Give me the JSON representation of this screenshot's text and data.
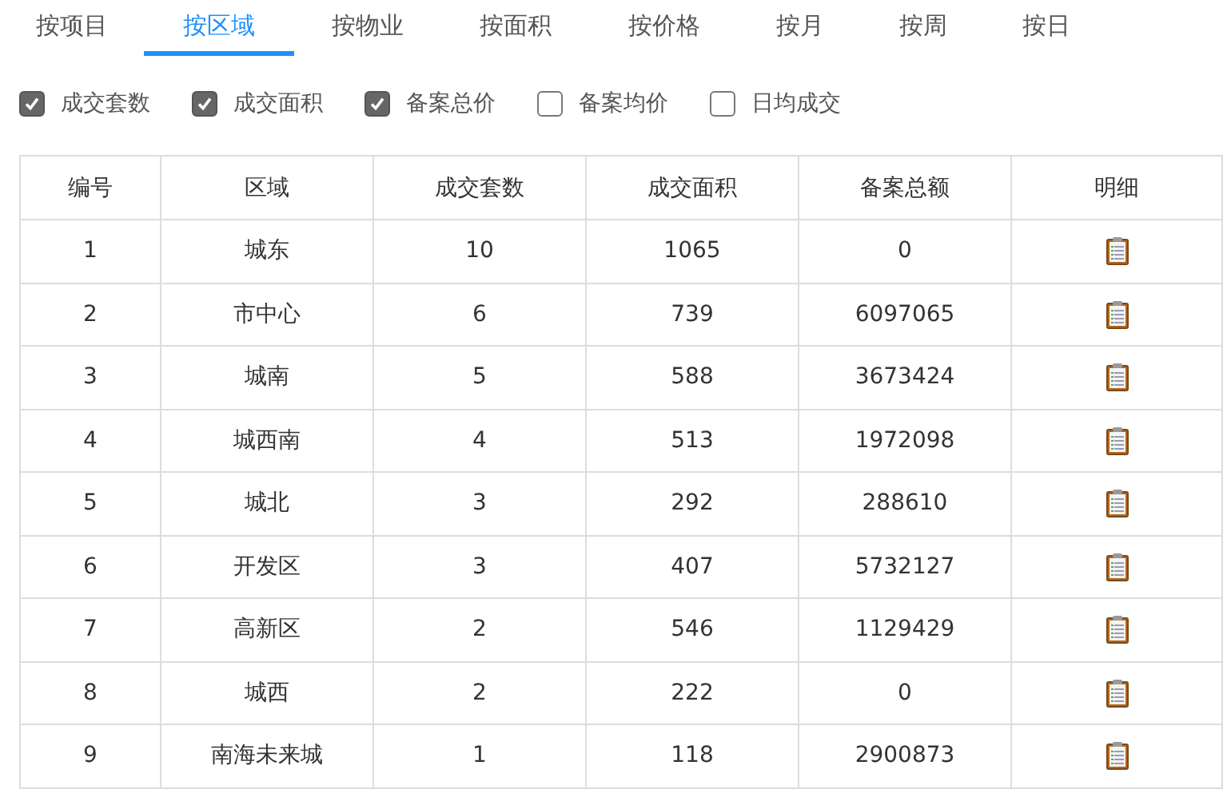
{
  "tabs": [
    {
      "label": "按项目",
      "selected": false
    },
    {
      "label": "按区域",
      "selected": true
    },
    {
      "label": "按物业",
      "selected": false
    },
    {
      "label": "按面积",
      "selected": false
    },
    {
      "label": "按价格",
      "selected": false
    },
    {
      "label": "按月",
      "selected": false
    },
    {
      "label": "按周",
      "selected": false
    },
    {
      "label": "按日",
      "selected": false
    }
  ],
  "options": [
    {
      "label": "成交套数",
      "checked": true
    },
    {
      "label": "成交面积",
      "checked": true
    },
    {
      "label": "备案总价",
      "checked": true
    },
    {
      "label": "备案均价",
      "checked": false
    },
    {
      "label": "日均成交",
      "checked": false
    }
  ],
  "table": {
    "columns": [
      "编号",
      "区域",
      "成交套数",
      "成交面积",
      "备案总额",
      "明细"
    ],
    "rows": [
      [
        "1",
        "城东",
        "10",
        "1065",
        "0"
      ],
      [
        "2",
        "市中心",
        "6",
        "739",
        "6097065"
      ],
      [
        "3",
        "城南",
        "5",
        "588",
        "3673424"
      ],
      [
        "4",
        "城西南",
        "4",
        "513",
        "1972098"
      ],
      [
        "5",
        "城北",
        "3",
        "292",
        "288610"
      ],
      [
        "6",
        "开发区",
        "3",
        "407",
        "5732127"
      ],
      [
        "7",
        "高新区",
        "2",
        "546",
        "1129429"
      ],
      [
        "8",
        "城西",
        "2",
        "222",
        "0"
      ],
      [
        "9",
        "南海未来城",
        "1",
        "118",
        "2900873"
      ]
    ]
  }
}
